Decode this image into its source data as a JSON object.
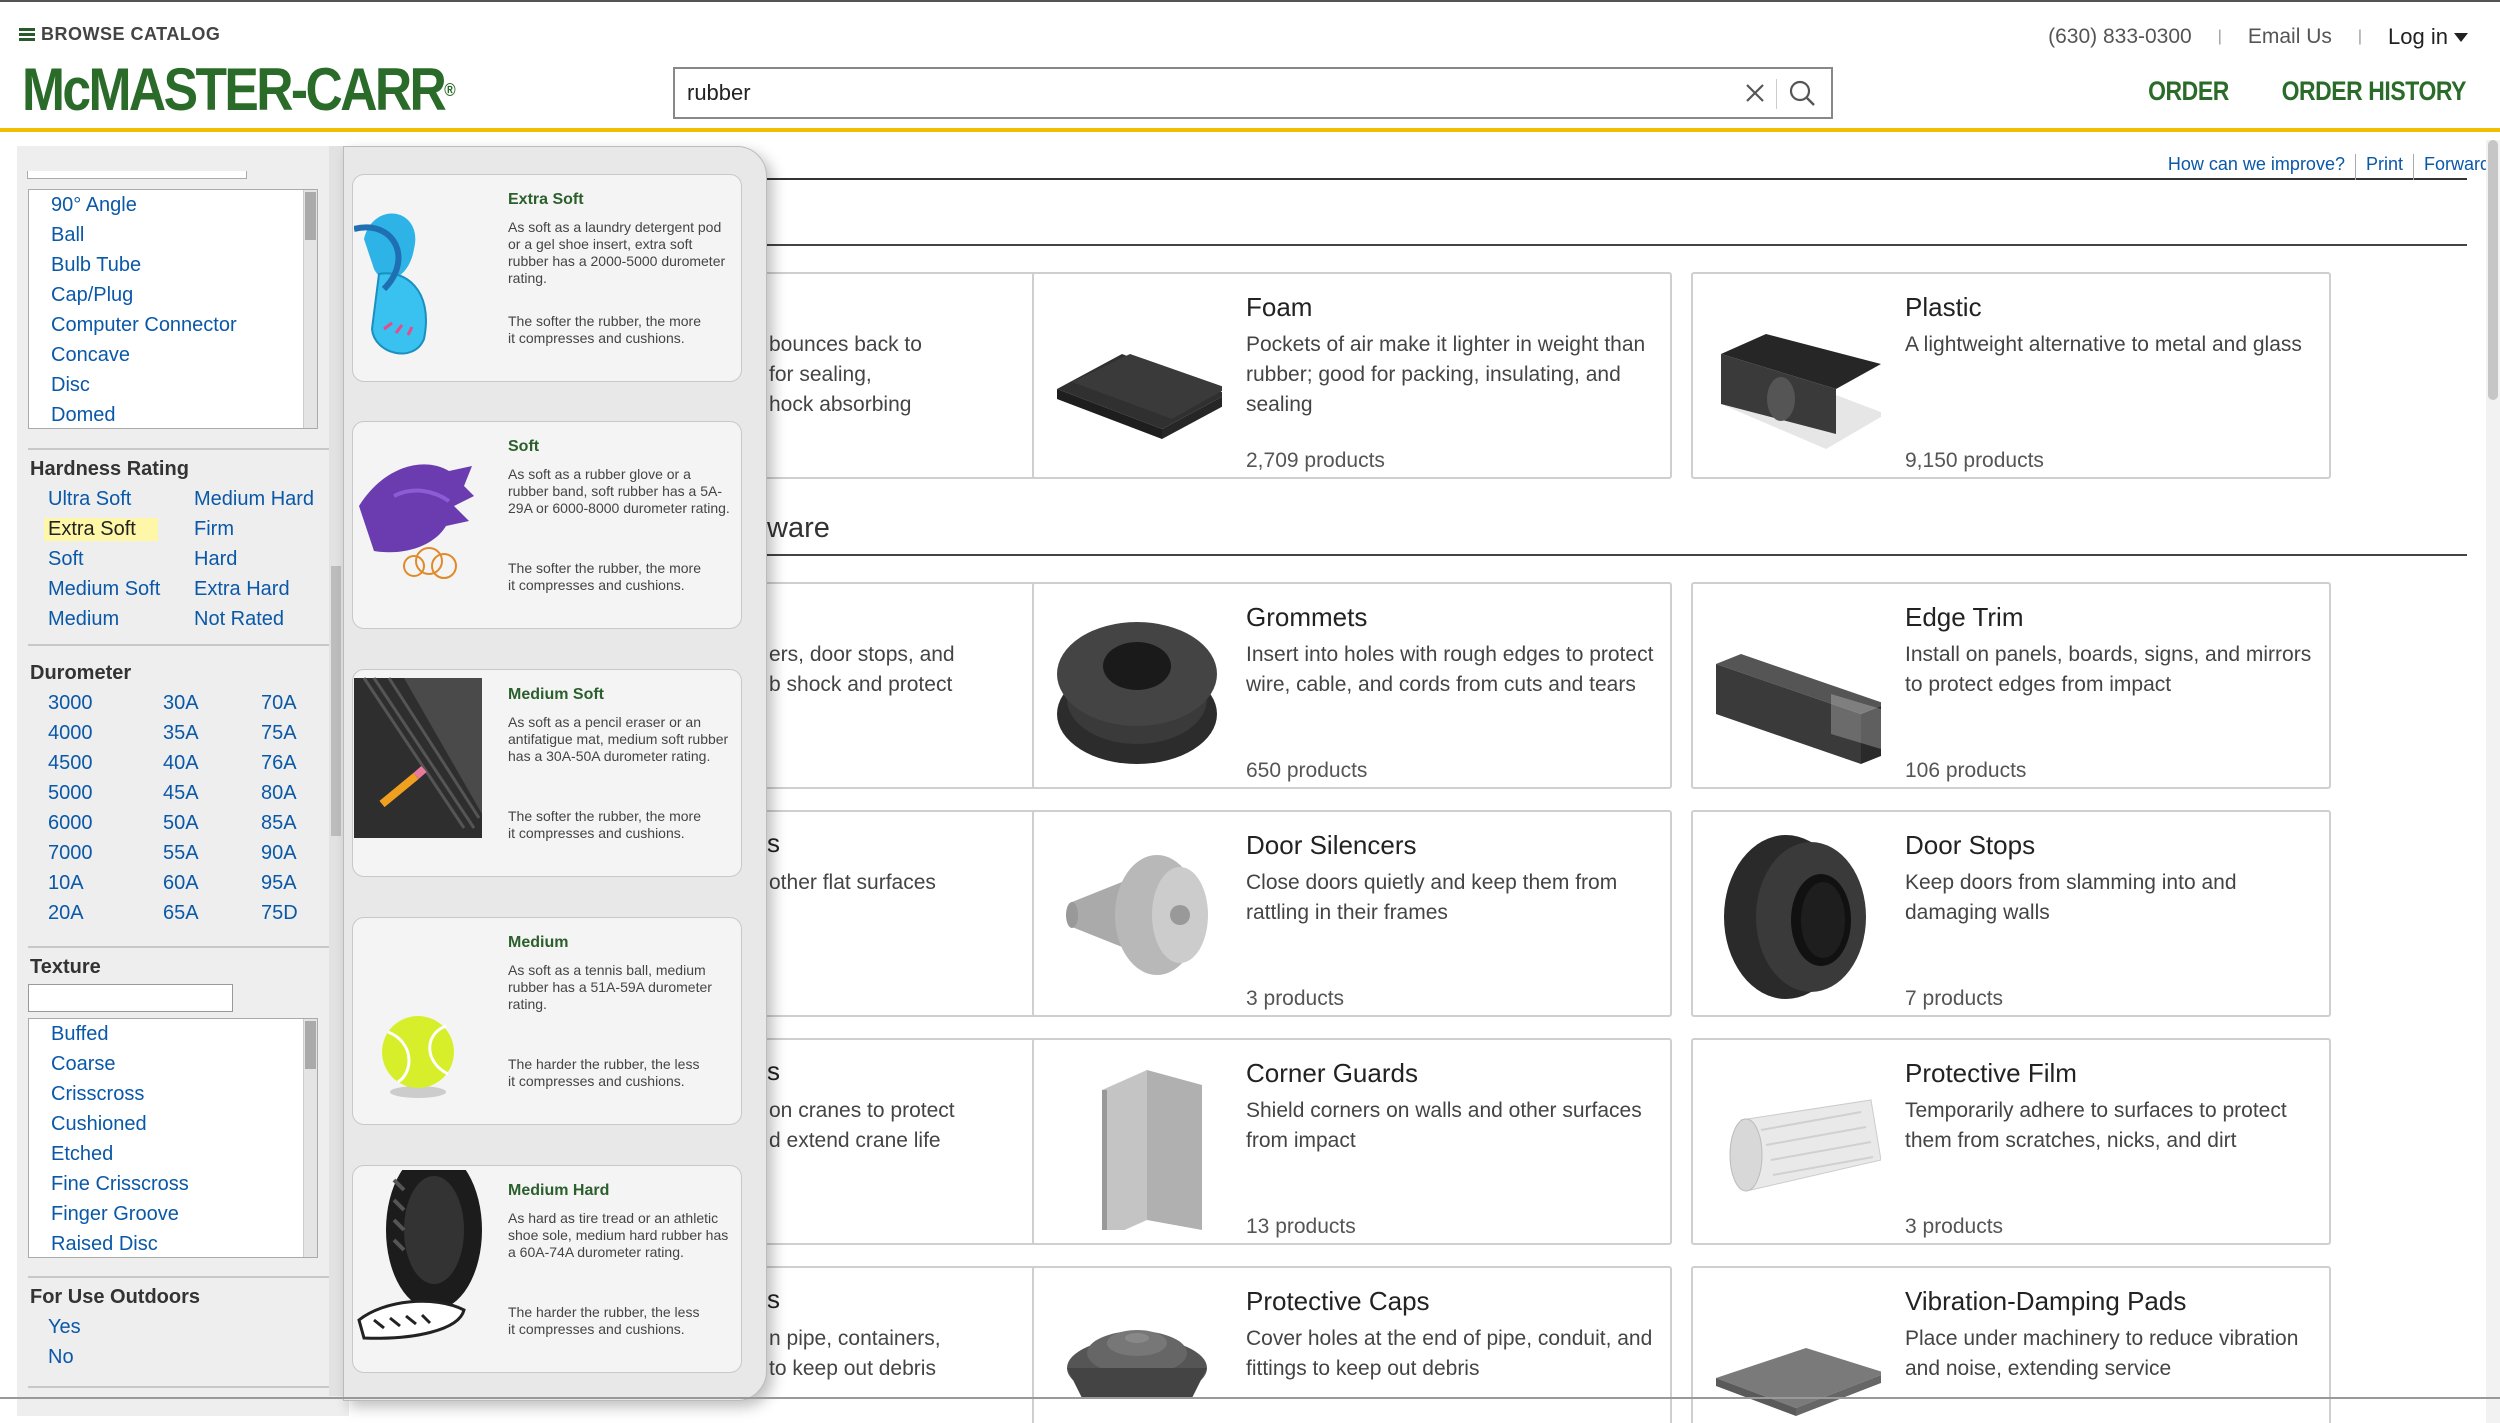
{
  "header": {
    "browse_label": "BROWSE CATALOG",
    "logo_text": "McMASTER-CARR",
    "phone": "(630) 833-0300",
    "email_label": "Email Us",
    "login_label": "Log in",
    "order_label": "ORDER",
    "order_history_label": "ORDER HISTORY",
    "search_value": "rubber",
    "accent_color": "#f0c000",
    "brand_color": "#2a6b2a"
  },
  "feedback": {
    "improve": "How can we improve?",
    "print": "Print",
    "forward": "Forward"
  },
  "filters": {
    "shape_list": [
      "90° Angle",
      "Ball",
      "Bulb Tube",
      "Cap/Plug",
      "Computer Connector",
      "Concave",
      "Disc",
      "Domed"
    ],
    "hardness": {
      "heading": "Hardness Rating",
      "col1": [
        "Ultra Soft",
        "Extra Soft",
        "Soft",
        "Medium Soft",
        "Medium"
      ],
      "col2": [
        "Medium Hard",
        "Firm",
        "Hard",
        "Extra Hard",
        "Not Rated"
      ],
      "selected": "Extra Soft"
    },
    "durometer": {
      "heading": "Durometer",
      "col1": [
        "3000",
        "4000",
        "4500",
        "5000",
        "6000",
        "7000",
        "10A",
        "20A"
      ],
      "col2": [
        "30A",
        "35A",
        "40A",
        "45A",
        "50A",
        "55A",
        "60A",
        "65A"
      ],
      "col3": [
        "70A",
        "75A",
        "76A",
        "80A",
        "85A",
        "90A",
        "95A",
        "75D"
      ]
    },
    "texture": {
      "heading": "Texture",
      "items": [
        "Buffed",
        "Coarse",
        "Crisscross",
        "Cushioned",
        "Etched",
        "Fine Crisscross",
        "Finger Groove",
        "Raised Disc"
      ]
    },
    "outdoors": {
      "heading": "For Use Outdoors",
      "items": [
        "Yes",
        "No"
      ]
    }
  },
  "popover": {
    "cards": [
      {
        "title": "Extra Soft",
        "desc": "As soft as a laundry detergent pod or a gel shoe insert, extra soft rubber has a 2000-5000 durometer rating.",
        "note": "The softer the rubber, the more it compresses and cushions.",
        "icon": "gel-insole-icon"
      },
      {
        "title": "Soft",
        "desc": "As soft as a rubber glove or a rubber band, soft rubber has a 5A-29A or 6000-8000 durometer rating.",
        "note": "The softer the rubber, the more it compresses and cushions.",
        "icon": "rubber-glove-icon"
      },
      {
        "title": "Medium Soft",
        "desc": "As soft as a pencil eraser or an antifatigue mat, medium soft rubber has a 30A-50A durometer rating.",
        "note": "The softer the rubber, the more it compresses and cushions.",
        "icon": "antifatigue-mat-icon"
      },
      {
        "title": "Medium",
        "desc": "As soft as a tennis ball, medium rubber has a 51A-59A durometer rating.",
        "note": "The harder the rubber, the less it compresses and cushions.",
        "icon": "tennis-ball-icon"
      },
      {
        "title": "Medium Hard",
        "desc": "As hard as tire tread or an athletic shoe sole, medium hard rubber has a 60A-74A durometer rating.",
        "note": "The harder the rubber, the less it compresses and cushions.",
        "icon": "tire-icon"
      }
    ]
  },
  "main": {
    "section2_title": "ware",
    "partial_cards": [
      "bounces back to\n for sealing,\nhock absorbing",
      "ers, door stops, and\nb shock and protect",
      "other flat surfaces",
      "on cranes to protect\nd extend crane life",
      "n pipe, containers,\nto keep out debris"
    ],
    "partial_titles": [
      "s",
      "s",
      "s"
    ],
    "cards": [
      {
        "title": "Foam",
        "desc": "Pockets of air make it lighter in weight than rubber; good for packing, insulating, and sealing",
        "count": "2,709 products",
        "icon": "foam-strip-icon"
      },
      {
        "title": "Plastic",
        "desc": "A lightweight alternative to metal and glass",
        "count": "9,150 products",
        "icon": "plastic-strip-icon"
      },
      {
        "title": "Grommets",
        "desc": "Insert into holes with rough edges to protect wire, cable, and cords from cuts and tears",
        "count": "650 products",
        "icon": "grommet-icon"
      },
      {
        "title": "Edge Trim",
        "desc": "Install on panels, boards, signs, and mirrors to protect edges from impact",
        "count": "106 products",
        "icon": "edge-trim-icon"
      },
      {
        "title": "Door Silencers",
        "desc": "Close doors quietly and keep them from rattling in their frames",
        "count": "3 products",
        "icon": "door-silencer-icon"
      },
      {
        "title": "Door Stops",
        "desc": "Keep doors from slamming into and damaging walls",
        "count": "7 products",
        "icon": "door-stop-icon"
      },
      {
        "title": "Corner Guards",
        "desc": "Shield corners on walls and other surfaces from impact",
        "count": "13 products",
        "icon": "corner-guard-icon"
      },
      {
        "title": "Protective Film",
        "desc": "Temporarily adhere to surfaces to protect them from scratches, nicks, and dirt",
        "count": "3 products",
        "icon": "protective-film-icon"
      },
      {
        "title": "Protective Caps",
        "desc": "Cover holes at the end of pipe, conduit, and fittings to keep out debris",
        "count": "",
        "icon": "protective-cap-icon"
      },
      {
        "title": "Vibration-Damping Pads",
        "desc": "Place under machinery to reduce vibration and noise, extending service",
        "count": "",
        "icon": "damping-pad-icon"
      }
    ]
  }
}
